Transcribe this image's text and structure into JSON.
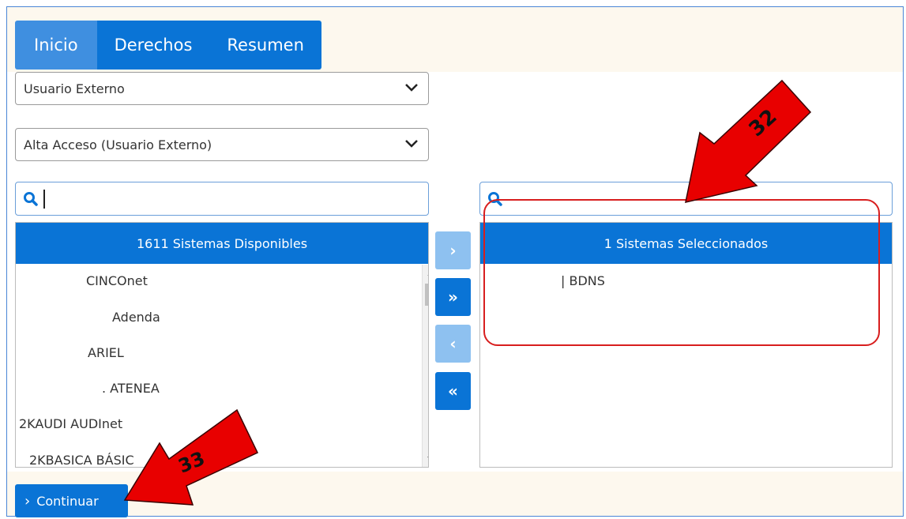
{
  "tabs": [
    {
      "label": "Inicio",
      "active": true
    },
    {
      "label": "Derechos",
      "active": false
    },
    {
      "label": "Resumen",
      "active": false
    }
  ],
  "selects": {
    "user_type": {
      "value": "Usuario Externo"
    },
    "request_type": {
      "value": "Alta Acceso (Usuario Externo)"
    }
  },
  "available": {
    "header": "1611 Sistemas Disponibles",
    "items": [
      "CINCOnet",
      "Adenda",
      "ARIEL",
      ". ATENEA",
      "2KAUDI AUDInet",
      "2KBASICA BÁSIC"
    ]
  },
  "selected": {
    "header": "1 Sistemas Seleccionados",
    "items": [
      "| BDNS"
    ]
  },
  "move_buttons": {
    "add_one": "›",
    "add_all": "»",
    "remove_one": "‹",
    "remove_all": "«"
  },
  "actions": {
    "continue_label": "Continuar"
  },
  "annotations": {
    "arrow_32": "32",
    "arrow_33": "33"
  },
  "colors": {
    "primary": "#0a74d6",
    "primary_light": "#8ec1f0",
    "annotation": "#e80000",
    "band": "#fdf8ee"
  },
  "icons": [
    "search-icon",
    "chevron-down-icon",
    "chevron-right-icon"
  ]
}
